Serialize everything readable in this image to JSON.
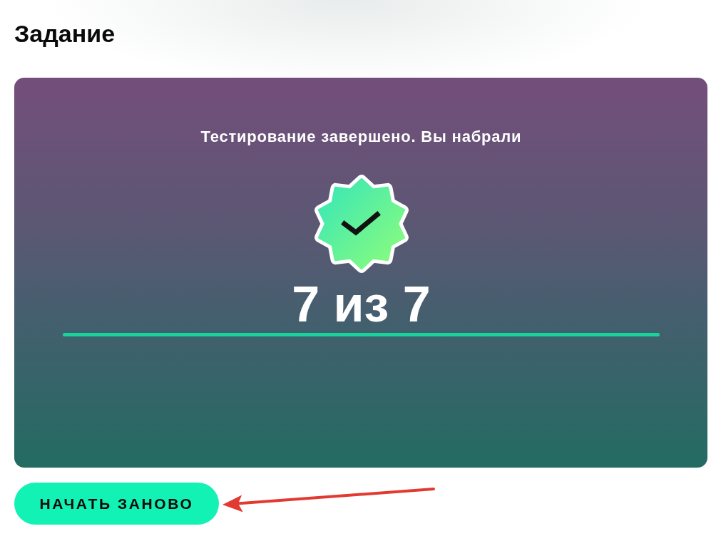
{
  "heading": "Задание",
  "result_card": {
    "message": "Тестирование завершено. Вы набрали",
    "score": "7 из 7",
    "progress": {
      "level": 1
    }
  },
  "buttons": [
    {
      "label": "НАЧАТЬ ЗАНОВО"
    }
  ]
}
